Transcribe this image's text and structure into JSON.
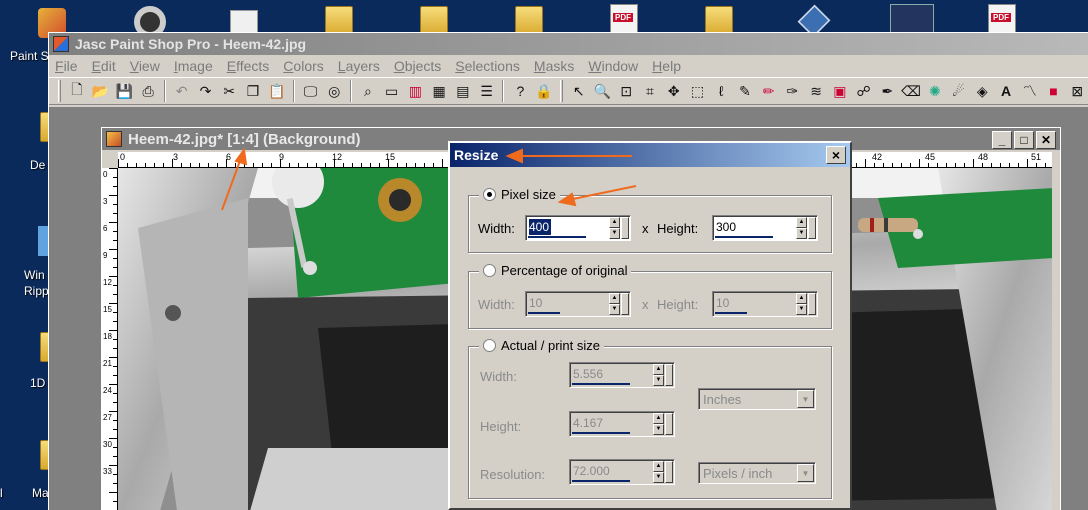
{
  "desktop": {
    "labels": [
      "Paint S",
      "De",
      "Win",
      "Ripp",
      "1D",
      "Ma",
      "l"
    ]
  },
  "app": {
    "title": "Jasc Paint Shop Pro - Heem-42.jpg",
    "menu": [
      "File",
      "Edit",
      "View",
      "Image",
      "Effects",
      "Colors",
      "Layers",
      "Objects",
      "Selections",
      "Masks",
      "Window",
      "Help"
    ],
    "toolbar_icons": [
      "new",
      "open",
      "save",
      "print",
      "undo",
      "redo",
      "cut",
      "copy",
      "paste",
      "screen",
      "browse",
      "zoom",
      "overview",
      "histogram",
      "channels",
      "layers-palette",
      "help",
      "lock",
      "pointer",
      "zoom-tool",
      "deform",
      "crop",
      "mover",
      "selection",
      "freehand",
      "dropper",
      "paint-brush",
      "clone",
      "scratch",
      "color-replace",
      "retouch",
      "eraser",
      "picture-tube",
      "airbrush",
      "flood-fill",
      "text",
      "draw",
      "preset-shapes",
      "object-selector"
    ]
  },
  "image_window": {
    "title": "Heem-42.jpg* [1:4] (Background)",
    "ruler_h": [
      "0",
      "3",
      "6",
      "9",
      "12",
      "15",
      "42",
      "45",
      "48",
      "51"
    ],
    "ruler_v": [
      "0",
      "3",
      "6",
      "9",
      "12",
      "15",
      "18",
      "21",
      "24",
      "27",
      "30",
      "33"
    ]
  },
  "dialog": {
    "title": "Resize",
    "close": "×",
    "pixel": {
      "label": "Pixel size",
      "width_label": "Width:",
      "width_value": "400",
      "height_label": "Height:",
      "height_value": "300",
      "x": "x"
    },
    "percent": {
      "label": "Percentage of original",
      "width_label": "Width:",
      "width_value": "10",
      "height_label": "Height:",
      "height_value": "10",
      "x": "x"
    },
    "actual": {
      "label": "Actual / print size",
      "width_label": "Width:",
      "width_value": "5.556",
      "height_label": "Height:",
      "height_value": "4.167",
      "resolution_label": "Resolution:",
      "resolution_value": "72.000",
      "units": "Inches",
      "res_units": "Pixels / inch"
    }
  },
  "colors": {
    "annotation_arrow": "#f06a1e",
    "dialog_title": "#0a246a"
  }
}
